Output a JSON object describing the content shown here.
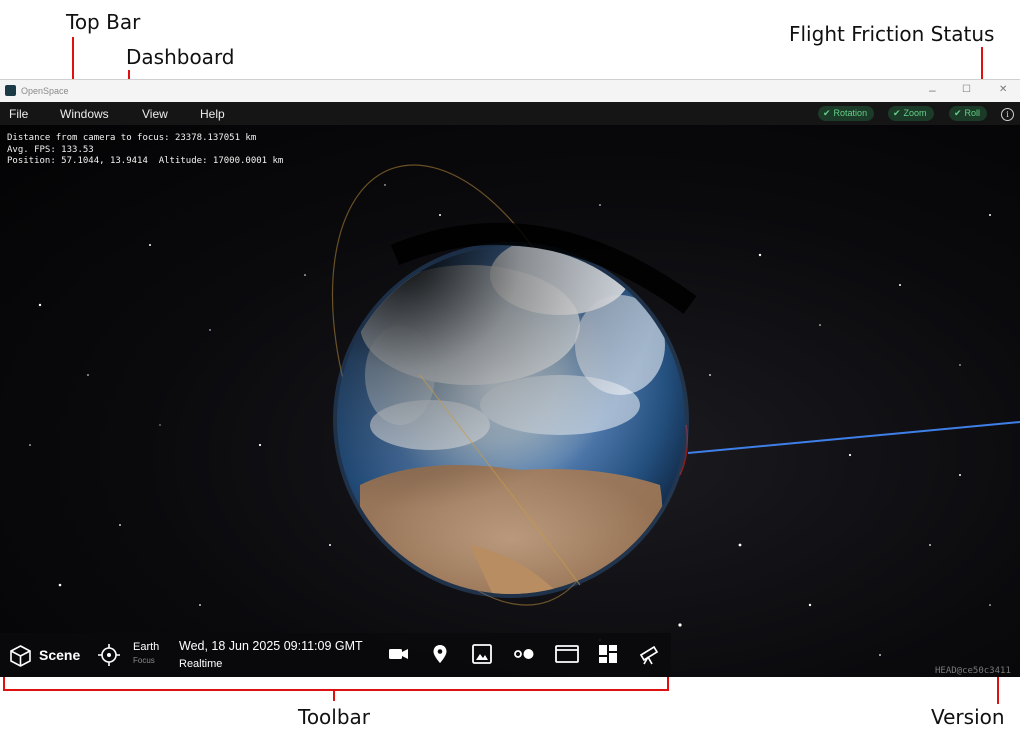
{
  "annotations": {
    "top_bar": "Top Bar",
    "dashboard": "Dashboard",
    "flight_friction_status": "Flight Friction Status",
    "toolbar": "Toolbar",
    "version": "Version"
  },
  "window": {
    "title": "OpenSpace",
    "controls": {
      "minimize": "–",
      "maximize": "☐",
      "close": "✕"
    }
  },
  "menu": {
    "items": [
      "File",
      "Windows",
      "View",
      "Help"
    ]
  },
  "friction": {
    "items": [
      {
        "label": "Rotation",
        "check": "✔"
      },
      {
        "label": "Zoom",
        "check": "✔"
      },
      {
        "label": "Roll",
        "check": "✔"
      }
    ],
    "info": "i",
    "accent_color": "#66d08a"
  },
  "dashboard": {
    "line1": "Distance from camera to focus: 23378.137051 km",
    "line2": "Avg. FPS: 133.53",
    "line3": "Position: 57.1044, 13.9414  Altitude: 17000.0001 km"
  },
  "toolbar": {
    "scene_label": "Scene",
    "focus_name": "Earth",
    "focus_caption": "Focus",
    "date": "Wed, 18 Jun 2025 09:11:09 GMT",
    "time_mode": "Realtime",
    "icons": [
      "camera-icon",
      "location-pin-icon",
      "image-icon",
      "dots-icon",
      "window-icon",
      "layout-icon",
      "telescope-icon"
    ]
  },
  "version": "HEAD@ce50c3411",
  "annotation_color": "#e01010"
}
